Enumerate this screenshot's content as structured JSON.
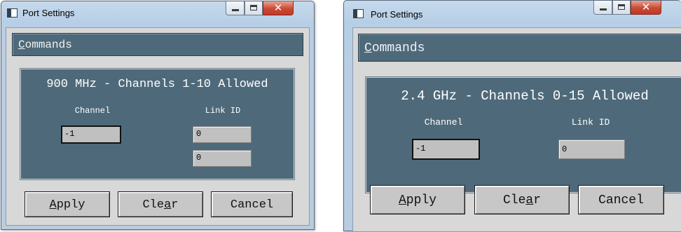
{
  "left_window": {
    "title": "Port Settings",
    "commands_label": "Commands",
    "commands_mnemonic": "C",
    "commands_rest": "ommands",
    "band_title": "900 MHz - Channels 1-10 Allowed",
    "channel_label": "Channel",
    "channel_value": "-1",
    "link_id_label": "Link ID",
    "link_id_values": [
      "0",
      "0"
    ],
    "buttons": {
      "apply": {
        "label": "Apply",
        "mnemonic": "A",
        "rest": "pply"
      },
      "clear": {
        "label": "Clear",
        "before": "Cle",
        "mnemonic": "a",
        "after": "r"
      },
      "cancel": {
        "label": "Cancel"
      }
    }
  },
  "right_window": {
    "title": "Port Settings",
    "commands_label": "Commands",
    "commands_mnemonic": "C",
    "commands_rest": "ommands",
    "band_title": "2.4 GHz - Channels 0-15 Allowed",
    "channel_label": "Channel",
    "channel_value": "-1",
    "link_id_label": "Link ID",
    "link_id_values": [
      "0"
    ],
    "buttons": {
      "apply": {
        "label": "Apply",
        "mnemonic": "A",
        "rest": "pply"
      },
      "clear": {
        "label": "Clear",
        "before": "Cle",
        "mnemonic": "a",
        "after": "r"
      },
      "cancel": {
        "label": "Cancel"
      }
    }
  },
  "icons": {
    "app": "app-window-icon",
    "minimize": "minimize-icon",
    "maximize": "maximize-icon",
    "close": "close-icon"
  },
  "colors": {
    "panel_bg": "#4e6a7a",
    "client_bg": "#d8d8d8",
    "close_button": "#c94a33"
  }
}
